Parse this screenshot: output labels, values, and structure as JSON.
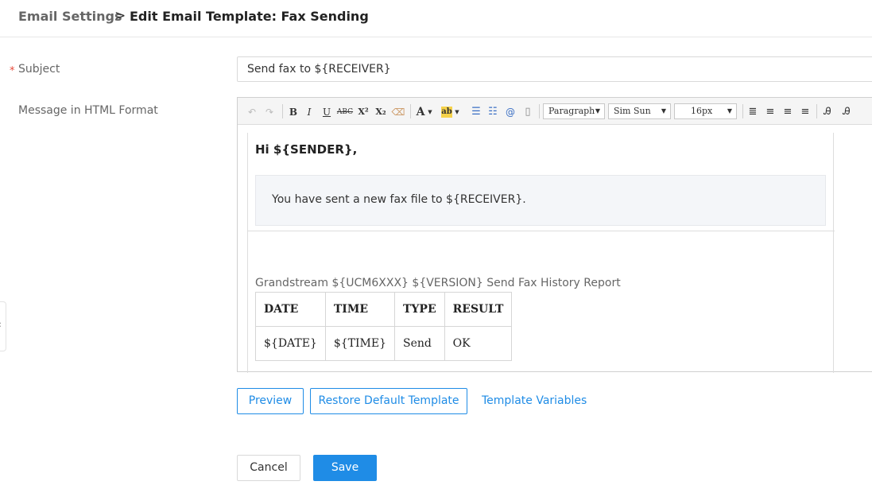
{
  "breadcrumb": {
    "parent": "Email Settings",
    "separator": ">",
    "current": "Edit Email Template: Fax Sending"
  },
  "form": {
    "required_marker": "*",
    "subject_label": "Subject",
    "subject_value": "Send fax to ${RECEIVER}",
    "message_label": "Message in HTML Format"
  },
  "toolbar": {
    "undo_icon": "undo-icon",
    "redo_icon": "redo-icon",
    "bold": "B",
    "italic": "I",
    "underline": "U",
    "strike": "ABC",
    "superscript": "X²",
    "subscript": "X₂",
    "font_color": "A",
    "highlight": "ab",
    "format_select": "Paragraph",
    "font_family_select": "Sim Sun",
    "font_size_select": "16px"
  },
  "editor": {
    "greeting": "Hi ${SENDER},",
    "message": "You have sent a new fax file to ${RECEIVER}.",
    "report_title": "Grandstream ${UCM6XXX} ${VERSION} Send Fax History Report",
    "table": {
      "headers": [
        "DATE",
        "TIME",
        "TYPE",
        "RESULT"
      ],
      "rows": [
        [
          "${DATE}",
          "${TIME}",
          "Send",
          "OK"
        ]
      ]
    }
  },
  "actions": {
    "preview": "Preview",
    "restore": "Restore Default Template",
    "variables": "Template Variables",
    "cancel": "Cancel",
    "save": "Save"
  },
  "colors": {
    "accent": "#1f8ce6",
    "required": "#e64a3b"
  }
}
